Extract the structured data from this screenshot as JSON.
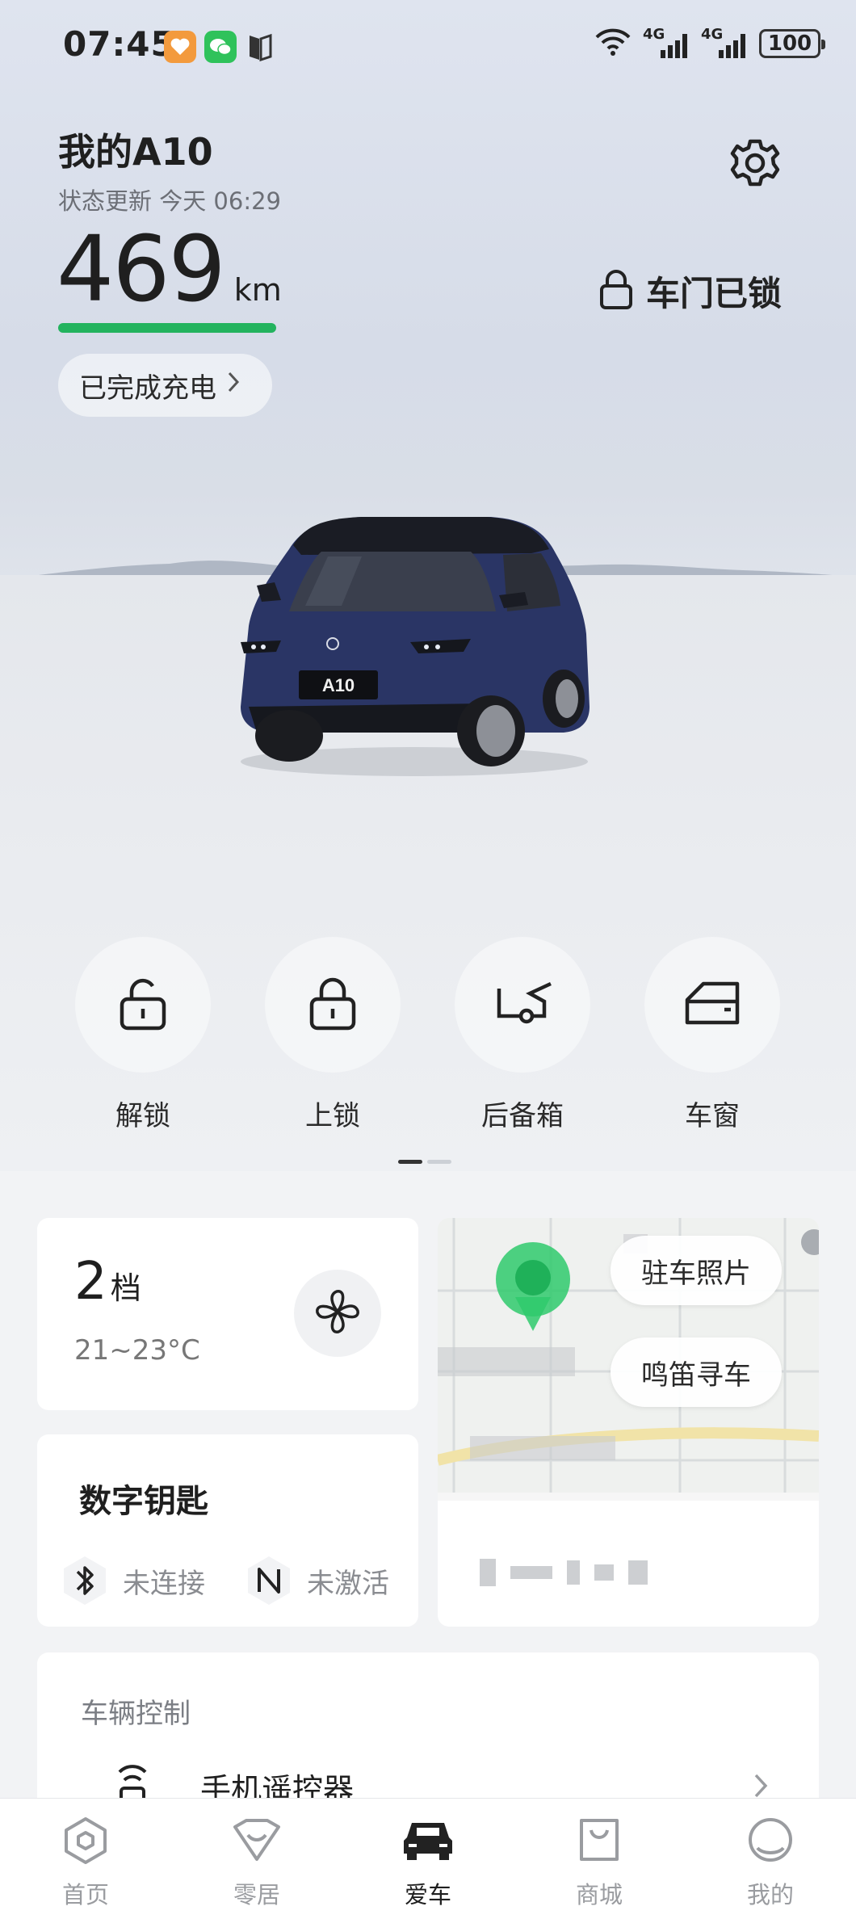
{
  "status_bar": {
    "time": "07:45",
    "network_1": "4G",
    "network_2": "4G",
    "battery": "100",
    "icons": [
      "heart-app-icon",
      "wechat-icon",
      "book-icon",
      "wifi-icon",
      "signal-icon",
      "battery-icon"
    ]
  },
  "header": {
    "car_name": "我的A10",
    "status_update": "状态更新 今天 06:29",
    "range_value": "469",
    "range_unit": "km",
    "range_fill": 1.0,
    "charge_status": "已完成充电",
    "lock_status": "车门已锁",
    "accent_color": "#23b35e"
  },
  "car": {
    "plate": "A10",
    "body_color": "#2a3565"
  },
  "quick_actions": [
    {
      "label": "解锁",
      "icon": "unlock-icon"
    },
    {
      "label": "上锁",
      "icon": "lock-icon"
    },
    {
      "label": "后备箱",
      "icon": "trunk-icon"
    },
    {
      "label": "车窗",
      "icon": "window-icon"
    }
  ],
  "pager": {
    "pages": 2,
    "current": 1
  },
  "ac_card": {
    "level": "2",
    "level_unit": "档",
    "temp_range": "21~23°C",
    "icon": "fan-icon"
  },
  "key_card": {
    "title": "数字钥匙",
    "bluetooth_status": "未连接",
    "nfc_status": "未激活"
  },
  "map_card": {
    "parking_photo": "驻车照片",
    "find_car": "鸣笛寻车"
  },
  "control_card": {
    "title": "车辆控制",
    "remote": "手机遥控器"
  },
  "bottom_nav": [
    {
      "label": "首页",
      "icon": "home-icon",
      "active": false
    },
    {
      "label": "零居",
      "icon": "heart-shield-icon",
      "active": false
    },
    {
      "label": "爱车",
      "icon": "car-icon",
      "active": true
    },
    {
      "label": "商城",
      "icon": "shopping-bag-icon",
      "active": false
    },
    {
      "label": "我的",
      "icon": "profile-icon",
      "active": false
    }
  ]
}
